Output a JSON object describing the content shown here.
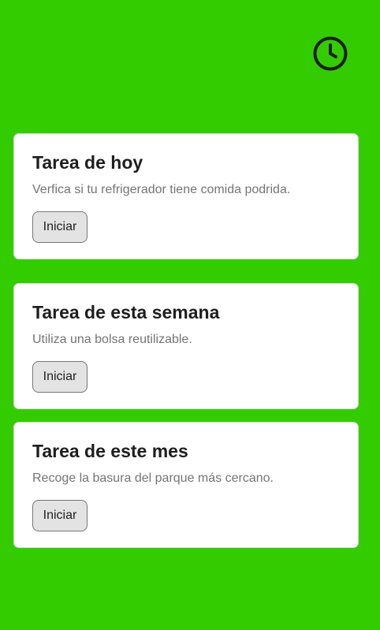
{
  "header": {
    "history_icon": "clock-icon",
    "icon_color": "#1e1e1e"
  },
  "theme": {
    "background": "#33cc00",
    "card_background": "#ffffff"
  },
  "tasks": [
    {
      "title": "Tarea de hoy",
      "description": "Verfica si tu refrigerador tiene comida podrida.",
      "button_label": "Iniciar"
    },
    {
      "title": "Tarea de esta semana",
      "description": "Utiliza una bolsa reutilizable.",
      "button_label": "Iniciar"
    },
    {
      "title": "Tarea de este mes",
      "description": "Recoge la basura del parque más cercano.",
      "button_label": "Iniciar"
    }
  ]
}
